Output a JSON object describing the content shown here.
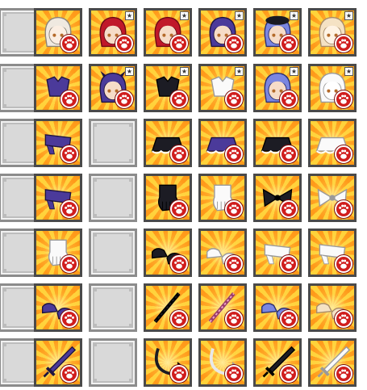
{
  "inventory": {
    "columns": 7,
    "rows": [
      [
        {
          "type": "empty"
        },
        {
          "type": "item",
          "icon": "pale-hair-head-icon",
          "star": false
        },
        {
          "type": "item",
          "icon": "red-hair-head-icon",
          "star": true
        },
        {
          "type": "item",
          "icon": "red-hair-head-icon",
          "star": true
        },
        {
          "type": "item",
          "icon": "purple-hair-head-icon",
          "star": true
        },
        {
          "type": "item",
          "icon": "blue-hair-hat-head-icon",
          "star": true
        },
        {
          "type": "item",
          "icon": "cream-hair-head-icon",
          "star": true
        }
      ],
      [
        {
          "type": "empty"
        },
        {
          "type": "item",
          "icon": "purple-bra-icon",
          "star": false
        },
        {
          "type": "item",
          "icon": "purple-hair-horned-head-icon",
          "star": true
        },
        {
          "type": "item",
          "icon": "black-outfit-top-icon",
          "star": true
        },
        {
          "type": "item",
          "icon": "white-outfit-top-icon",
          "star": true
        },
        {
          "type": "item",
          "icon": "blue-long-hair-head-icon",
          "star": true
        },
        {
          "type": "item",
          "icon": "white-long-hair-head-icon",
          "star": true
        }
      ],
      [
        {
          "type": "empty"
        },
        {
          "type": "item",
          "icon": "purple-bottom-icon",
          "star": false
        },
        {
          "type": "empty"
        },
        {
          "type": "item",
          "icon": "black-skirt-icon",
          "star": false
        },
        {
          "type": "item",
          "icon": "purple-skirt-icon",
          "star": false
        },
        {
          "type": "item",
          "icon": "black-frill-skirt-icon",
          "star": false
        },
        {
          "type": "item",
          "icon": "white-frill-skirt-icon",
          "star": false
        }
      ],
      [
        {
          "type": "empty"
        },
        {
          "type": "item",
          "icon": "purple-stockings-icon",
          "star": false
        },
        {
          "type": "empty"
        },
        {
          "type": "item",
          "icon": "black-white-gloves-icon",
          "star": false
        },
        {
          "type": "item",
          "icon": "white-gloves-icon",
          "star": false
        },
        {
          "type": "item",
          "icon": "black-hair-bow-icon",
          "star": false
        },
        {
          "type": "item",
          "icon": "white-hair-bow-icon",
          "star": false
        }
      ],
      [
        {
          "type": "empty"
        },
        {
          "type": "item",
          "icon": "white-glove-icon",
          "star": false
        },
        {
          "type": "empty"
        },
        {
          "type": "item",
          "icon": "black-shoes-icon",
          "star": false
        },
        {
          "type": "item",
          "icon": "white-shoes-icon",
          "star": false
        },
        {
          "type": "item",
          "icon": "white-stockings-icon",
          "star": false
        },
        {
          "type": "item",
          "icon": "white-stockings-icon",
          "star": false
        }
      ],
      [
        {
          "type": "empty"
        },
        {
          "type": "item",
          "icon": "purple-sandals-icon",
          "star": false
        },
        {
          "type": "empty"
        },
        {
          "type": "item",
          "icon": "black-lace-ribbon-icon",
          "star": false
        },
        {
          "type": "item",
          "icon": "pink-lace-ribbon-icon",
          "star": false
        },
        {
          "type": "item",
          "icon": "blue-sneakers-icon",
          "star": false
        },
        {
          "type": "item",
          "icon": "cream-sneakers-icon",
          "star": false
        }
      ],
      [
        {
          "type": "empty"
        },
        {
          "type": "item",
          "icon": "purple-fan-weapon-icon",
          "star": false
        },
        {
          "type": "empty"
        },
        {
          "type": "item",
          "icon": "black-tail-icon",
          "star": false
        },
        {
          "type": "item",
          "icon": "white-tail-icon",
          "star": false
        },
        {
          "type": "item",
          "icon": "black-sword-icon",
          "star": false
        },
        {
          "type": "item",
          "icon": "white-sword-icon",
          "star": false
        }
      ]
    ],
    "badge_icon": "paw-badge-icon",
    "star_glyph": "★",
    "colors": {
      "paw_badge": "#d01d1d",
      "slot_border": "#4a4a4a",
      "empty_slot": "#d9d9d9",
      "burst_light": "#ffd23a",
      "burst_dark": "#ff9a1a"
    }
  }
}
